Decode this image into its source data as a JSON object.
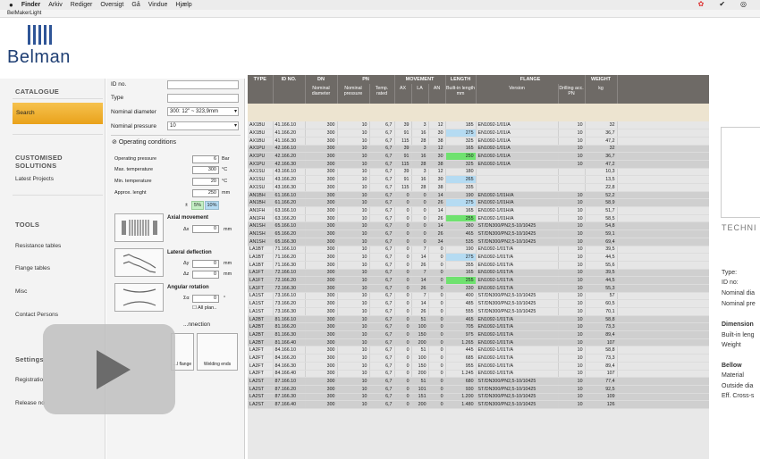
{
  "menubar": {
    "apple": "",
    "items": [
      "Finder",
      "Arkiv",
      "Rediger",
      "Oversigt",
      "Gå",
      "Vindue",
      "Hjælp"
    ]
  },
  "window": {
    "title": "BelMakerLight"
  },
  "logo": {
    "text": "Belman"
  },
  "sidebar": {
    "catalogue": "CATALOGUE",
    "search": "Search",
    "customised": "CUSTOMISED SOLUTIONS",
    "latest": "Latest Projects",
    "tools": "TOOLS",
    "resistance": "Resistance tables",
    "flange": "Flange tables",
    "misc": "Misc",
    "contact": "Contact Persons",
    "settings": "Settings",
    "registration": "Registratio",
    "release": "Release no"
  },
  "form": {
    "id_label": "ID no.",
    "type_label": "Type",
    "nd_label": "Nominal diameter",
    "nd_value": "300: 12\" ~ 323,9mm",
    "np_label": "Nominal pressure",
    "np_value": "10",
    "operating": "Operating conditions",
    "op_pressure": "Operating pressure",
    "op_pressure_val": "6",
    "op_pressure_unit": "Bar",
    "max_temp": "Max. temperature",
    "max_temp_val": "300",
    "max_temp_unit": "°C",
    "min_temp": "Min. temperature",
    "min_temp_val": "20",
    "min_temp_unit": "°C",
    "approx": "Approx. lenght",
    "approx_val": "250",
    "approx_unit": "mm",
    "tol_pm": "±",
    "tol_5": "5%",
    "tol_10": "10%",
    "axial": "Axial movement",
    "dx": "Δx",
    "dx_val": "0",
    "dx_unit": "mm",
    "lateral": "Lateral deflection",
    "dy": "Δy",
    "dy_val": "0",
    "dz": "Δz",
    "dz_val": "0",
    "lat_unit": "mm",
    "angular": "Angular rotation",
    "angular_sym": "Σα",
    "angular_val": "0",
    "angular_unit": "°",
    "all_planes": "All plan..",
    "connection": "...nnection",
    "flange_btn": "...l flange",
    "welding_btn": "Welding ends"
  },
  "table": {
    "groups": [
      "TYPE",
      "ID NO.",
      "DN",
      "PN",
      "MOVEMENT",
      "LENGTH",
      "FLANGE",
      "WEIGHT"
    ],
    "sub": [
      "",
      "",
      "Nominal diameter",
      "Nominal pressure",
      "Temp. rated",
      "AX",
      "LA",
      "AN",
      "Built-in length mm",
      "Version",
      "Drilling acc. PN",
      "kg"
    ],
    "rows": [
      [
        "AX1BU",
        "41.166.10",
        "300",
        "10",
        "6,7",
        "39",
        "3",
        "12",
        "185",
        "EN1092-1/01/A",
        "10",
        "32",
        0,
        ""
      ],
      [
        "AX1BU",
        "41.166.20",
        "300",
        "10",
        "6,7",
        "91",
        "16",
        "30",
        "275",
        "EN1092-1/01/A",
        "10",
        "36,7",
        0,
        "b"
      ],
      [
        "AX1BU",
        "41.166.30",
        "300",
        "10",
        "6,7",
        "115",
        "28",
        "38",
        "325",
        "EN1092-1/01/A",
        "10",
        "47,2",
        0,
        ""
      ],
      [
        "AX1PU",
        "42.166.10",
        "300",
        "10",
        "6,7",
        "39",
        "3",
        "12",
        "165",
        "EN1092-1/01/A",
        "10",
        "32",
        1,
        ""
      ],
      [
        "AX1PU",
        "42.166.20",
        "300",
        "10",
        "6,7",
        "91",
        "16",
        "30",
        "250",
        "EN1092-1/01/A",
        "10",
        "36,7",
        1,
        "g"
      ],
      [
        "AX1PU",
        "42.166.30",
        "300",
        "10",
        "6,7",
        "115",
        "28",
        "38",
        "325",
        "EN1092-1/01/A",
        "10",
        "47,2",
        1,
        ""
      ],
      [
        "AX1SU",
        "43.166.10",
        "300",
        "10",
        "6,7",
        "39",
        "3",
        "12",
        "180",
        "",
        "",
        "10,3",
        0,
        ""
      ],
      [
        "AX1SU",
        "43.166.20",
        "300",
        "10",
        "6,7",
        "91",
        "16",
        "30",
        "265",
        "",
        "",
        "13,5",
        0,
        "b"
      ],
      [
        "AX1SU",
        "43.166.30",
        "300",
        "10",
        "6,7",
        "115",
        "28",
        "38",
        "335",
        "",
        "",
        "22,8",
        0,
        ""
      ],
      [
        "AN1BH",
        "61.166.10",
        "300",
        "10",
        "6,7",
        "0",
        "0",
        "14",
        "190",
        "EN1092-1/01H/A",
        "10",
        "52,2",
        1,
        ""
      ],
      [
        "AN1BH",
        "61.166.20",
        "300",
        "10",
        "6,7",
        "0",
        "0",
        "26",
        "275",
        "EN1092-1/01H/A",
        "10",
        "58,9",
        1,
        "b"
      ],
      [
        "AN1FH",
        "63.166.10",
        "300",
        "10",
        "6,7",
        "0",
        "0",
        "14",
        "165",
        "EN1092-1/01H/A",
        "10",
        "51,7",
        0,
        ""
      ],
      [
        "AN1FH",
        "63.166.20",
        "300",
        "10",
        "6,7",
        "0",
        "0",
        "26",
        "255",
        "EN1092-1/01H/A",
        "10",
        "58,5",
        0,
        "g"
      ],
      [
        "AN1SH",
        "65.166.10",
        "300",
        "10",
        "6,7",
        "0",
        "0",
        "14",
        "380",
        "ST/DN300/PN2,5-10/10425",
        "10",
        "54,8",
        1,
        ""
      ],
      [
        "AN1SH",
        "65.166.20",
        "300",
        "10",
        "6,7",
        "0",
        "0",
        "26",
        "465",
        "ST/DN300/PN2,5-10/10425",
        "10",
        "59,1",
        1,
        ""
      ],
      [
        "AN1SH",
        "65.166.30",
        "300",
        "10",
        "6,7",
        "0",
        "0",
        "34",
        "535",
        "ST/DN300/PN2,5-10/10425",
        "10",
        "69,4",
        1,
        ""
      ],
      [
        "LA1BT",
        "71.166.10",
        "300",
        "10",
        "6,7",
        "0",
        "7",
        "0",
        "190",
        "EN1092-1/01T/A",
        "10",
        "39,5",
        0,
        ""
      ],
      [
        "LA1BT",
        "71.166.20",
        "300",
        "10",
        "6,7",
        "0",
        "14",
        "0",
        "275",
        "EN1092-1/01T/A",
        "10",
        "44,5",
        0,
        "b"
      ],
      [
        "LA1BT",
        "71.166.30",
        "300",
        "10",
        "6,7",
        "0",
        "26",
        "0",
        "355",
        "EN1092-1/01T/A",
        "10",
        "55,6",
        0,
        ""
      ],
      [
        "LA1FT",
        "72.166.10",
        "300",
        "10",
        "6,7",
        "0",
        "7",
        "0",
        "165",
        "EN1092-1/01T/A",
        "10",
        "39,5",
        1,
        ""
      ],
      [
        "LA1FT",
        "72.166.20",
        "300",
        "10",
        "6,7",
        "0",
        "14",
        "0",
        "255",
        "EN1092-1/01T/A",
        "10",
        "44,5",
        1,
        "g"
      ],
      [
        "LA1FT",
        "72.166.30",
        "300",
        "10",
        "6,7",
        "0",
        "26",
        "0",
        "330",
        "EN1092-1/01T/A",
        "10",
        "55,3",
        1,
        ""
      ],
      [
        "LA1ST",
        "73.166.10",
        "300",
        "10",
        "6,7",
        "0",
        "7",
        "0",
        "400",
        "ST/DN300/PN2,5-10/10425",
        "10",
        "57",
        0,
        ""
      ],
      [
        "LA1ST",
        "73.166.20",
        "300",
        "10",
        "6,7",
        "0",
        "14",
        "0",
        "485",
        "ST/DN300/PN2,5-10/10425",
        "10",
        "60,5",
        0,
        ""
      ],
      [
        "LA1ST",
        "73.166.30",
        "300",
        "10",
        "6,7",
        "0",
        "26",
        "0",
        "555",
        "ST/DN300/PN2,5-10/10425",
        "10",
        "70,1",
        0,
        ""
      ],
      [
        "LA2BT",
        "81.166.10",
        "300",
        "10",
        "6,7",
        "0",
        "51",
        "0",
        "465",
        "EN1092-1/01T/A",
        "10",
        "58,8",
        1,
        ""
      ],
      [
        "LA2BT",
        "81.166.20",
        "300",
        "10",
        "6,7",
        "0",
        "100",
        "0",
        "705",
        "EN1092-1/01T/A",
        "10",
        "73,3",
        1,
        ""
      ],
      [
        "LA2BT",
        "81.166.30",
        "300",
        "10",
        "6,7",
        "0",
        "150",
        "0",
        "975",
        "EN1092-1/01T/A",
        "10",
        "89,4",
        1,
        ""
      ],
      [
        "LA2BT",
        "81.166.40",
        "300",
        "10",
        "6,7",
        "0",
        "200",
        "0",
        "1.265",
        "EN1092-1/01T/A",
        "10",
        "107",
        1,
        ""
      ],
      [
        "LA2FT",
        "84.166.10",
        "300",
        "10",
        "6,7",
        "0",
        "51",
        "0",
        "445",
        "EN1092-1/01T/A",
        "10",
        "58,8",
        0,
        ""
      ],
      [
        "LA2FT",
        "84.166.20",
        "300",
        "10",
        "6,7",
        "0",
        "100",
        "0",
        "685",
        "EN1092-1/01T/A",
        "10",
        "73,3",
        0,
        ""
      ],
      [
        "LA2FT",
        "84.166.30",
        "300",
        "10",
        "6,7",
        "0",
        "150",
        "0",
        "955",
        "EN1092-1/01T/A",
        "10",
        "89,4",
        0,
        ""
      ],
      [
        "LA2FT",
        "84.166.40",
        "300",
        "10",
        "6,7",
        "0",
        "200",
        "0",
        "1.245",
        "EN1092-1/01T/A",
        "10",
        "107",
        0,
        ""
      ],
      [
        "LA2ST",
        "87.166.10",
        "300",
        "10",
        "6,7",
        "0",
        "51",
        "0",
        "680",
        "ST/DN300/PN2,5-10/10425",
        "10",
        "77,4",
        1,
        ""
      ],
      [
        "LA2ST",
        "87.166.20",
        "300",
        "10",
        "6,7",
        "0",
        "101",
        "0",
        "930",
        "ST/DN300/PN2,5-10/10425",
        "10",
        "92,5",
        1,
        ""
      ],
      [
        "LA2ST",
        "87.166.30",
        "300",
        "10",
        "6,7",
        "0",
        "151",
        "0",
        "1.200",
        "ST/DN300/PN2,5-10/10425",
        "10",
        "109",
        1,
        ""
      ],
      [
        "LA2ST",
        "87.166.40",
        "300",
        "10",
        "6,7",
        "0",
        "200",
        "0",
        "1.480",
        "ST/DN300/PN2,5-10/10425",
        "10",
        "126",
        1,
        ""
      ]
    ]
  },
  "right": {
    "techni": "TECHNI",
    "type": "Type:",
    "idno": "ID no:",
    "nomd": "Nominal dia",
    "nomp": "Nominal pre",
    "dims": "Dimension",
    "builtin": "Built-in leng",
    "weight": "Weight",
    "bellow": "Bellow",
    "material": "Material",
    "outside": "Outside dia",
    "eff": "Eff. Cross-s"
  },
  "colors": {
    "accent": "#e9a21b",
    "header": "#6e6a66",
    "logo": "#1f3f74",
    "green": "#6fe26f",
    "blue": "#b5dbf2"
  }
}
